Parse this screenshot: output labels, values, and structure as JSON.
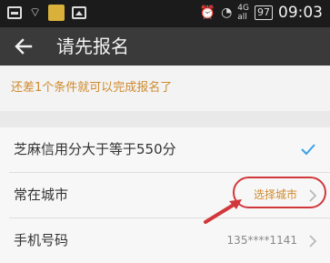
{
  "status_bar": {
    "network_label_top": "4G",
    "network_label_bottom": "all",
    "battery": "97",
    "time": "09:03"
  },
  "app_bar": {
    "back_icon": "arrow-left-icon",
    "title": "请先报名"
  },
  "notice": {
    "text": "还差1个条件就可以完成报名了"
  },
  "list": {
    "items": [
      {
        "label": "芝麻信用分大于等于550分",
        "status_icon": "check-icon"
      },
      {
        "label": "常在城市",
        "action_label": "选择城市",
        "chevron_icon": "chevron-right-icon"
      },
      {
        "label": "手机号码",
        "value": "135****1141",
        "chevron_icon": "chevron-right-icon"
      }
    ]
  },
  "colors": {
    "status_bar": "#1b1b1b",
    "app_bar": "#3a3a3a",
    "accent_orange": "#cf8a2c",
    "check_blue": "#3aa0e8",
    "annotation_red": "#d2373b"
  }
}
